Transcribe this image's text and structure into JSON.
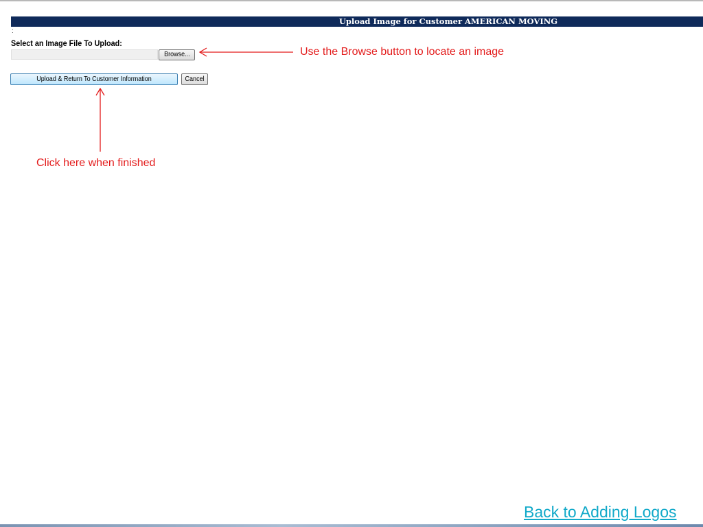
{
  "header": {
    "title": "Upload Image for Customer AMERICAN MOVING",
    "colon_mark": ":"
  },
  "form": {
    "select_label": "Select an Image File To Upload:",
    "file_input_value": "",
    "browse_label": "Browse...",
    "upload_label": "Upload & Return To Customer Information",
    "cancel_label": "Cancel"
  },
  "annotations": {
    "browse_hint": "Use the Browse button to locate an image",
    "finish_hint": "Click here when finished",
    "color": "#e31b1b"
  },
  "footer": {
    "back_link_label": "Back to Adding Logos",
    "link_color": "#11a9c9"
  },
  "colors": {
    "title_bar": "#0f2a5a"
  }
}
